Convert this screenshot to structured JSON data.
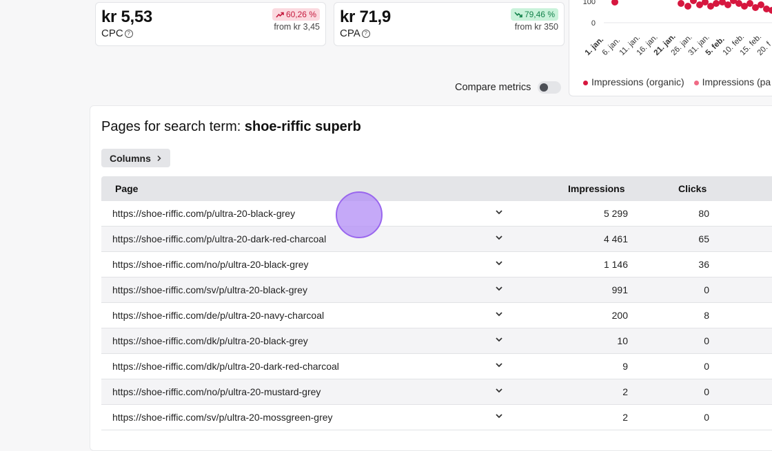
{
  "cards": [
    {
      "value": "kr 5,53",
      "label": "CPC",
      "badge": "60,26 %",
      "badge_dir": "up",
      "from": "from kr 3,45"
    },
    {
      "value": "kr 71,9",
      "label": "CPA",
      "badge": "79,46 %",
      "badge_dir": "down",
      "from": "from kr 350"
    }
  ],
  "chart": {
    "y_ticks": [
      "100",
      "0"
    ],
    "x_ticks": [
      "1. jan.",
      "6. jan.",
      "11. jan.",
      "16. jan.",
      "21. jan.",
      "26. jan.",
      "31. jan.",
      "5. feb.",
      "10. feb.",
      "15. feb.",
      "20. f"
    ],
    "legend": [
      {
        "name": "Impressions (organic)",
        "color": "#d6173f"
      },
      {
        "name": "Impressions (pa",
        "color": "#f06a85"
      }
    ]
  },
  "compare_label": "Compare metrics",
  "section": {
    "title_prefix": "Pages for search term: ",
    "title_term": "shoe-riffic superb",
    "columns_button": "Columns"
  },
  "table": {
    "headers": {
      "page": "Page",
      "impressions": "Impressions",
      "clicks": "Clicks"
    },
    "rows": [
      {
        "url": "https://shoe-riffic.com/p/ultra-20-black-grey",
        "impressions": "5 299",
        "clicks": "80"
      },
      {
        "url": "https://shoe-riffic.com/p/ultra-20-dark-red-charcoal",
        "impressions": "4 461",
        "clicks": "65"
      },
      {
        "url": "https://shoe-riffic.com/no/p/ultra-20-black-grey",
        "impressions": "1 146",
        "clicks": "36"
      },
      {
        "url": "https://shoe-riffic.com/sv/p/ultra-20-black-grey",
        "impressions": "991",
        "clicks": "0"
      },
      {
        "url": "https://shoe-riffic.com/de/p/ultra-20-navy-charcoal",
        "impressions": "200",
        "clicks": "8"
      },
      {
        "url": "https://shoe-riffic.com/dk/p/ultra-20-black-grey",
        "impressions": "10",
        "clicks": "0"
      },
      {
        "url": "https://shoe-riffic.com/dk/p/ultra-20-dark-red-charcoal",
        "impressions": "9",
        "clicks": "0"
      },
      {
        "url": "https://shoe-riffic.com/no/p/ultra-20-mustard-grey",
        "impressions": "2",
        "clicks": "0"
      },
      {
        "url": "https://shoe-riffic.com/sv/p/ultra-20-mossgreen-grey",
        "impressions": "2",
        "clicks": "0"
      }
    ]
  }
}
